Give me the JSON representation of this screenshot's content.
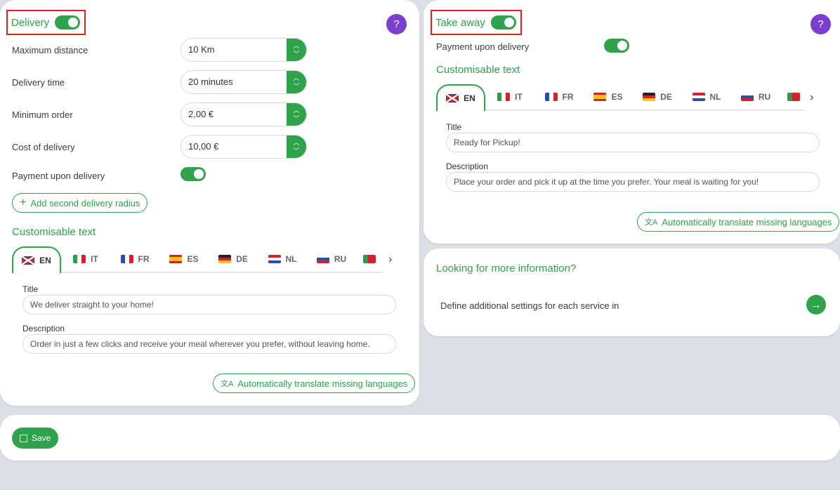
{
  "delivery": {
    "title": "Delivery",
    "enabled": true,
    "help": "?",
    "rows": [
      {
        "label": "Maximum distance",
        "value": "10 Km"
      },
      {
        "label": "Delivery time",
        "value": "20 minutes"
      },
      {
        "label": "Minimum order",
        "value": "2,00 €"
      },
      {
        "label": "Cost of delivery",
        "value": "10,00 €"
      }
    ],
    "payment_label": "Payment upon delivery",
    "payment_enabled": true,
    "add_radius": "Add second delivery radius",
    "custom_text_title": "Customisable text",
    "title_label": "Title",
    "title_value": "We deliver straight to your home!",
    "description_label": "Description",
    "description_value": "Order in just a few clicks and receive your meal wherever you prefer, without leaving home.",
    "translate": "Automatically translate missing languages"
  },
  "takeaway": {
    "title": "Take away",
    "enabled": true,
    "help": "?",
    "payment_label": "Payment upon delivery",
    "payment_enabled": true,
    "custom_text_title": "Customisable text",
    "title_label": "Title",
    "title_value": "Ready for Pickup!",
    "description_label": "Description",
    "description_value": "Place your order and pick it up at the time you prefer. Your meal is waiting for you!",
    "translate": "Automatically translate missing languages"
  },
  "languages": [
    "EN",
    "IT",
    "FR",
    "ES",
    "DE",
    "NL",
    "RU"
  ],
  "active_language": "EN",
  "info": {
    "title": "Looking for more information?",
    "text": "Define additional settings for each service in"
  },
  "save_label": "Save",
  "colors": {
    "accent": "#2fa24b",
    "help": "#7b3fd0",
    "highlight": "#e02020"
  }
}
